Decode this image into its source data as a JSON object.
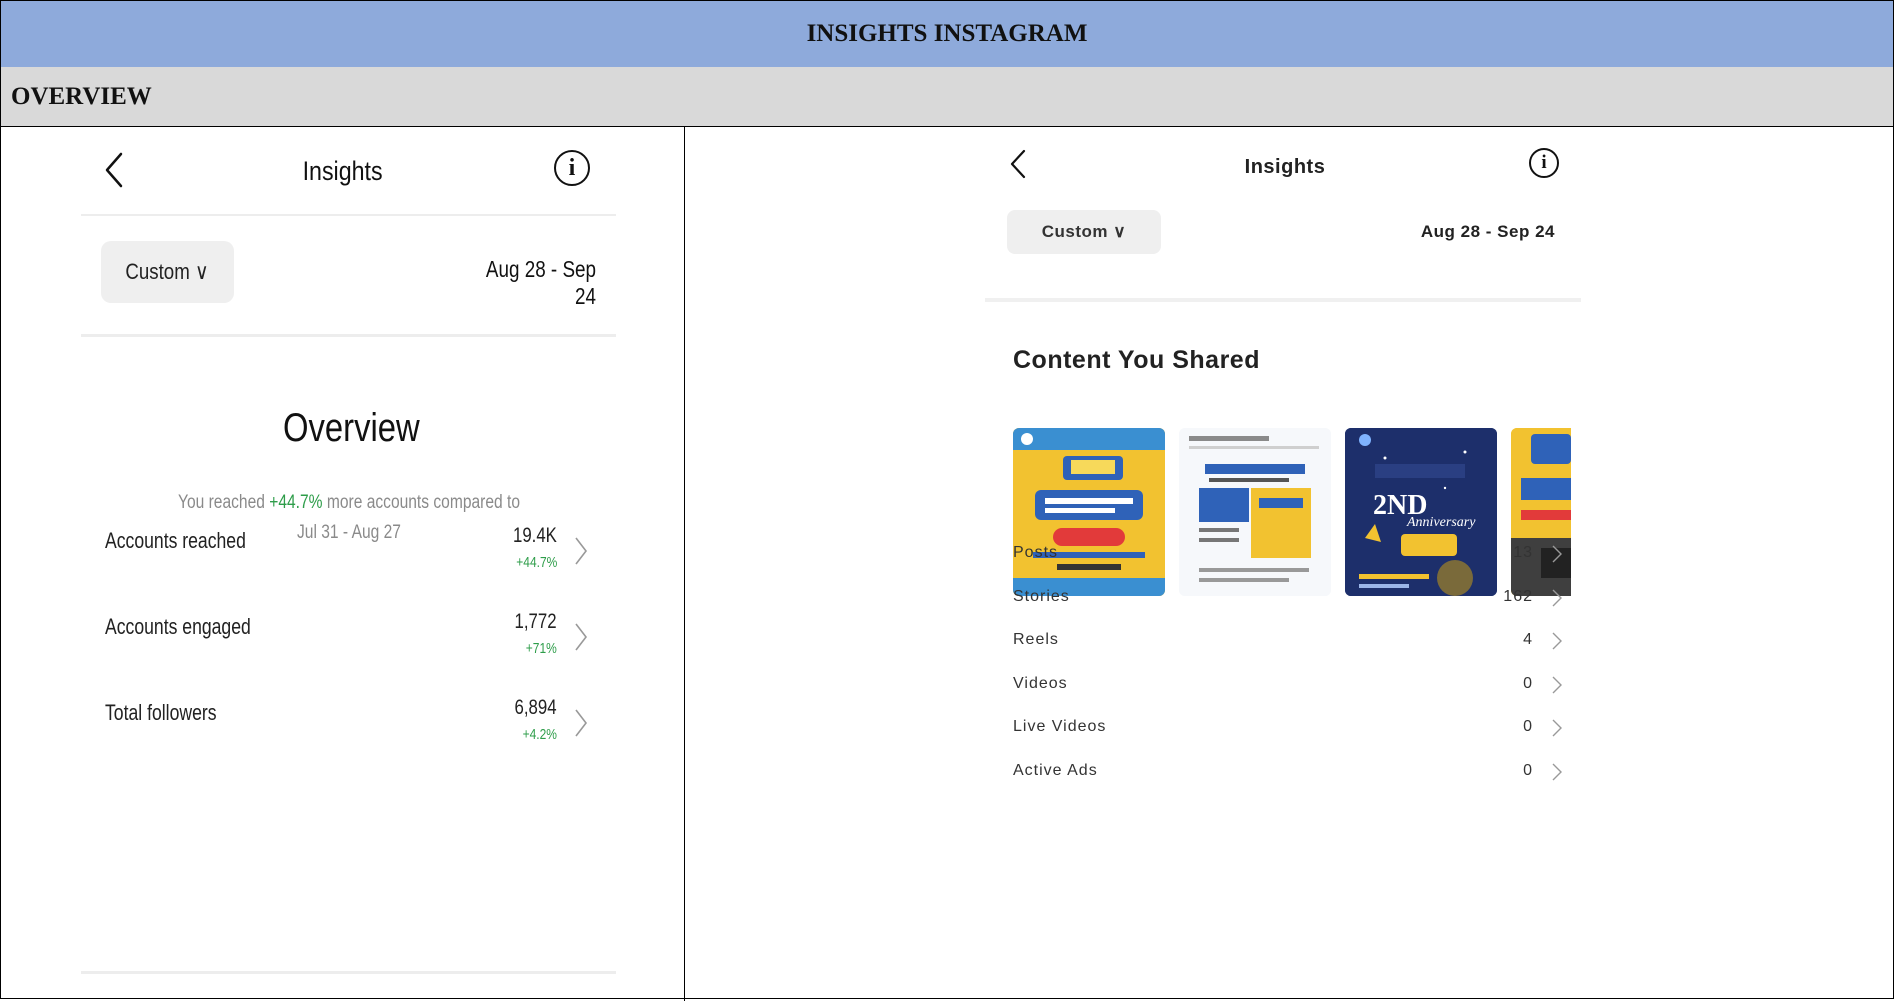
{
  "document": {
    "title": "INSIGHTS  INSTAGRAM",
    "section": "OVERVIEW"
  },
  "left_screen": {
    "header": {
      "title": "Insights",
      "info_icon": "i"
    },
    "range_button": "Custom ∨",
    "date_range": "Aug 28 - Sep 24",
    "overview_title": "Overview",
    "reach_text": {
      "prefix": "You reached ",
      "percent": "+44.7%",
      "suffix": " more accounts compared to Jul 31 - Aug 27"
    },
    "metrics": [
      {
        "label": "Accounts reached",
        "value": "19.4K",
        "change": "+44.7%"
      },
      {
        "label": "Accounts engaged",
        "value": "1,772",
        "change": "+71%"
      },
      {
        "label": "Total followers",
        "value": "6,894",
        "change": "+4.2%"
      }
    ]
  },
  "right_screen": {
    "header": {
      "title": "Insights",
      "info_icon": "i"
    },
    "range_button": "Custom ∨",
    "date_range": "Aug 28 - Sep 24",
    "content_heading": "Content You Shared",
    "thumbnails": [
      "post-thumbnail-yellow",
      "post-thumbnail-white",
      "post-thumbnail-navy",
      "post-thumbnail-yellow-partial"
    ],
    "thumbnail_texts": {
      "navy_title": "2ND",
      "navy_subtitle": "Anniversary"
    },
    "content_rows": [
      {
        "label": "Posts",
        "value": "13"
      },
      {
        "label": "Stories",
        "value": "162"
      },
      {
        "label": "Reels",
        "value": "4"
      },
      {
        "label": "Videos",
        "value": "0"
      },
      {
        "label": "Live Videos",
        "value": "0"
      },
      {
        "label": "Active Ads",
        "value": "0"
      }
    ]
  },
  "colors": {
    "title_bar": "#8eaadb",
    "section_bar": "#d9d9d9",
    "positive_green": "#2e9d4a",
    "thumb_yellow": "#f2c230",
    "thumb_navy": "#1d2f6b"
  }
}
